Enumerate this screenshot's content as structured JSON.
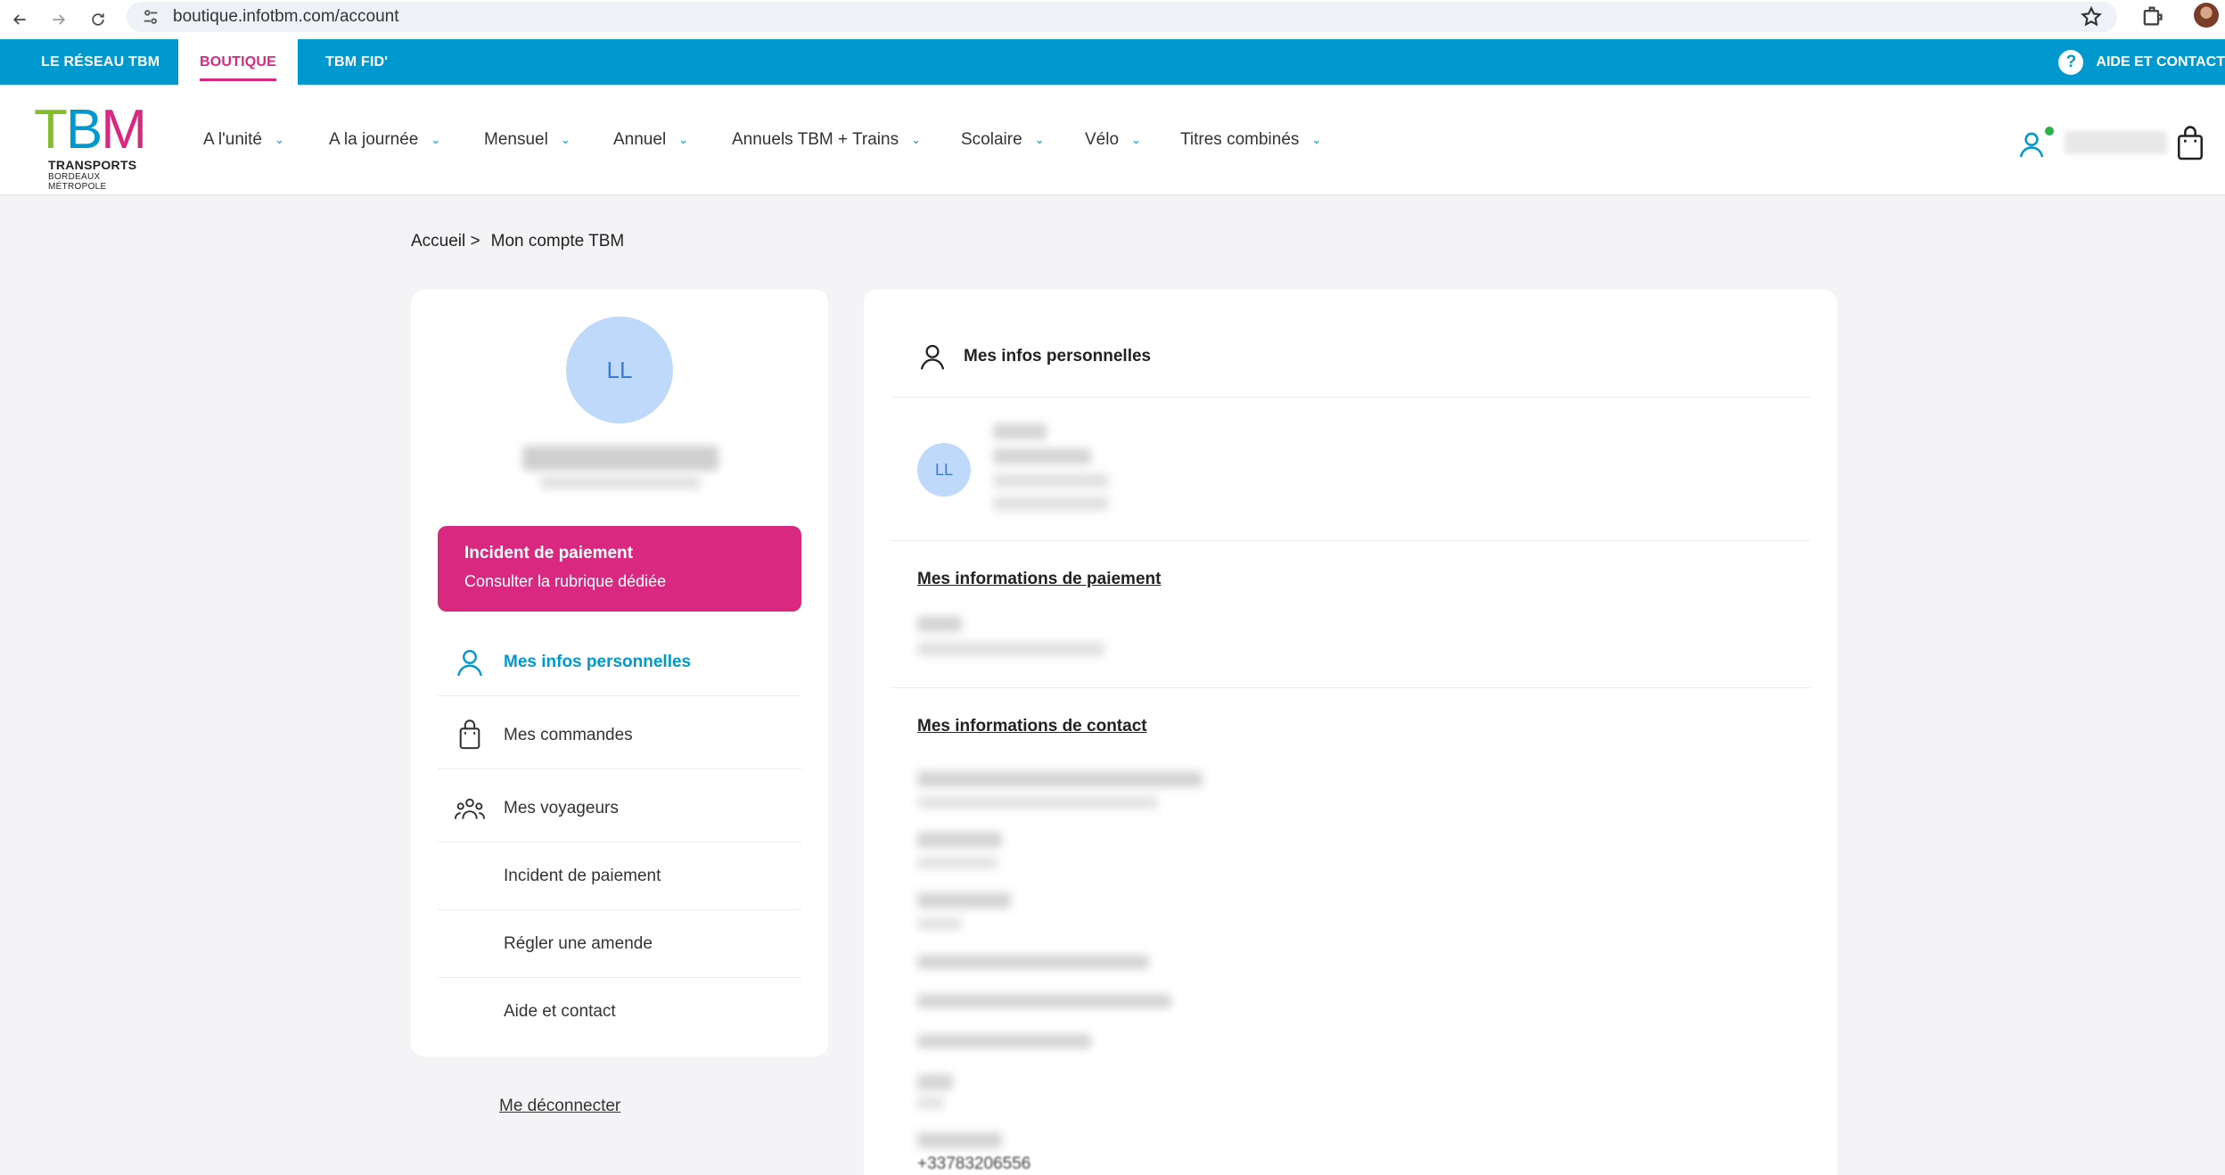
{
  "browser": {
    "url": "boutique.infotbm.com/account"
  },
  "topbar": {
    "tabs": [
      "LE RÉSEAU TBM",
      "BOUTIQUE",
      "TBM FID'"
    ],
    "help_label": "AIDE ET CONTACT",
    "help_icon_glyph": "?",
    "accent_color": "#0099cf",
    "active_color": "#d8287f"
  },
  "logo": {
    "letter1": "T",
    "letter2": "B",
    "letter3": "M",
    "line1": "TRANSPORTS",
    "line2": "BORDEAUX MÉTROPOLE"
  },
  "menu": {
    "items": [
      "A l'unité",
      "A la journée",
      "Mensuel",
      "Annuel",
      "Annuels TBM + Trains",
      "Scolaire",
      "Vélo",
      "Titres combinés"
    ],
    "chevron": "⌄"
  },
  "breadcrumb": {
    "home": "Accueil >",
    "current": "Mon compte TBM"
  },
  "profile": {
    "initials": "LL"
  },
  "incident_banner": {
    "title": "Incident de paiement",
    "subtitle": "Consulter la rubrique dédiée",
    "color": "#d8287f"
  },
  "account_menu": {
    "items": [
      {
        "label": "Mes infos personnelles",
        "icon": "user-icon"
      },
      {
        "label": "Mes commandes",
        "icon": "shopping-bag-icon"
      },
      {
        "label": "Mes voyageurs",
        "icon": "group-icon"
      },
      {
        "label": "Incident de paiement",
        "icon": ""
      },
      {
        "label": "Régler une amende",
        "icon": ""
      },
      {
        "label": "Aide et contact",
        "icon": ""
      }
    ],
    "logout_label": "Me déconnecter"
  },
  "main": {
    "section_title": "Mes infos personnelles",
    "payment_title": "Mes informations de paiement",
    "contact_title": "Mes informations de contact",
    "phone": "+33783206556"
  }
}
